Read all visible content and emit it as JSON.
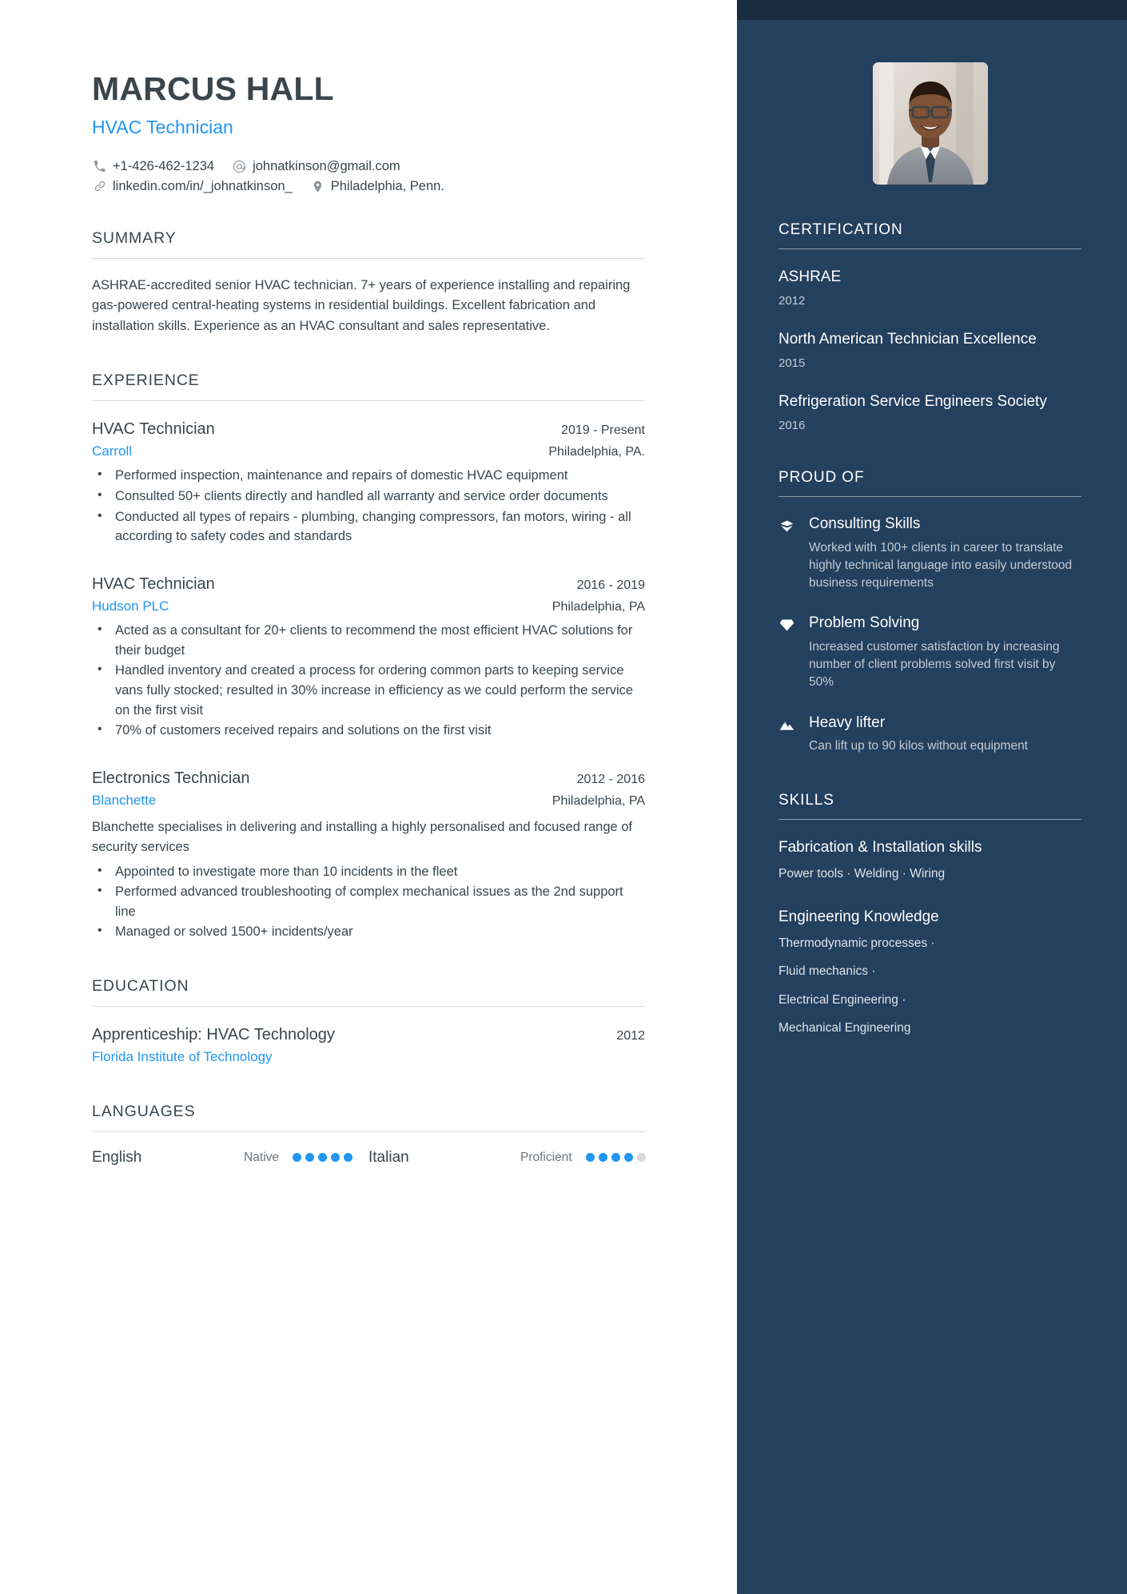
{
  "header": {
    "name": "MARCUS HALL",
    "job_title": "HVAC Technician",
    "contacts": [
      {
        "icon": "phone-icon",
        "text": "+1-426-462-1234"
      },
      {
        "icon": "email-icon",
        "text": "johnatkinson@gmail.com"
      },
      {
        "icon": "link-icon",
        "text": "linkedin.com/in/_johnatkinson_"
      },
      {
        "icon": "location-pin-icon",
        "text": "Philadelphia, Penn."
      }
    ]
  },
  "summary": {
    "heading": "SUMMARY",
    "text": "ASHRAE-accredited senior HVAC technician. 7+ years of experience installing and repairing gas-powered central-heating systems in residential buildings. Excellent fabrication and installation skills. Experience as an HVAC consultant and sales representative."
  },
  "experience": {
    "heading": "EXPERIENCE",
    "entries": [
      {
        "role": "HVAC Technician",
        "dates": "2019 - Present",
        "company": "Carroll",
        "location": "Philadelphia, PA.",
        "description": "",
        "bullets": [
          "Performed inspection, maintenance and repairs of domestic HVAC equipment",
          "Consulted 50+ clients directly and handled all warranty and service order documents",
          "Conducted all types of repairs - plumbing, changing compressors, fan motors, wiring - all according to safety codes and standards"
        ]
      },
      {
        "role": "HVAC Technician",
        "dates": "2016 - 2019",
        "company": "Hudson PLC",
        "location": "Philadelphia, PA",
        "description": "",
        "bullets": [
          "Acted as a consultant for 20+ clients to recommend the most efficient HVAC solutions for their budget",
          "Handled inventory and created a process for ordering common parts to keeping service vans fully stocked; resulted in 30% increase in efficiency as we could perform the service on the first visit",
          "70% of customers received repairs and solutions on the first visit"
        ]
      },
      {
        "role": "Electronics Technician",
        "dates": "2012 - 2016",
        "company": "Blanchette",
        "location": "Philadelphia, PA",
        "description": "Blanchette specialises in delivering and installing a highly personalised and focused range of security services",
        "bullets": [
          "Appointed to investigate more than 10 incidents in the fleet",
          "Performed advanced troubleshooting of complex mechanical issues as the 2nd support line",
          "Managed or solved 1500+ incidents/year"
        ]
      }
    ]
  },
  "education": {
    "heading": "EDUCATION",
    "entries": [
      {
        "degree": "Apprenticeship: HVAC Technology",
        "year": "2012",
        "school": "Florida Institute of Technology"
      }
    ]
  },
  "languages": {
    "heading": "LANGUAGES",
    "items": [
      {
        "name": "English",
        "level": "Native",
        "filled": 5,
        "total": 5
      },
      {
        "name": "Italian",
        "level": "Proficient",
        "filled": 4,
        "total": 5
      }
    ]
  },
  "certification": {
    "heading": "CERTIFICATION",
    "items": [
      {
        "name": "ASHRAE",
        "year": "2012"
      },
      {
        "name": "North American Technician Excellence",
        "year": "2015"
      },
      {
        "name": "Refrigeration Service Engineers Society",
        "year": "2016"
      }
    ]
  },
  "proud_of": {
    "heading": "PROUD OF",
    "items": [
      {
        "icon": "gem-icon",
        "title": "Consulting Skills",
        "description": "Worked with 100+ clients in career to translate highly technical language into easily understood business requirements"
      },
      {
        "icon": "diamond-icon",
        "title": "Problem Solving",
        "description": "Increased customer satisfaction by increasing number of client problems solved first visit by 50%"
      },
      {
        "icon": "mountain-icon",
        "title": "Heavy lifter",
        "description": "Can lift up to 90 kilos without equipment"
      }
    ]
  },
  "skills": {
    "heading": "SKILLS",
    "items": [
      {
        "name": "Fabrication & Installation skills",
        "values_inline": "Power tools · Welding · Wiring",
        "values_stacked": []
      },
      {
        "name": "Engineering Knowledge",
        "values_inline": "",
        "values_stacked": [
          "Thermodynamic processes ·",
          "Fluid mechanics ·",
          "Electrical Engineering ·",
          "Mechanical Engineering"
        ]
      }
    ]
  },
  "theme": {
    "accent": "#2196f3",
    "sidebar_bg": "#23405e",
    "sidebar_topbar_bg": "#1a2c40",
    "text": "#3a454c"
  }
}
